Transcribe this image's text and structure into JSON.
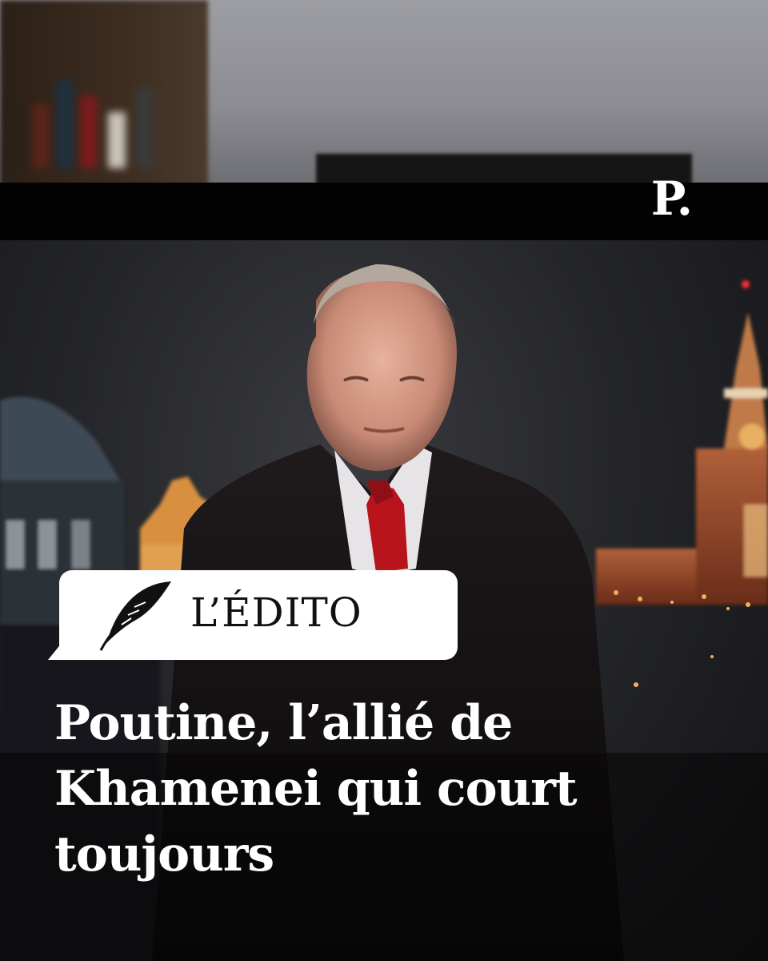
{
  "brand": {
    "logo_text": "P."
  },
  "badge": {
    "label": "L’ÉDITO",
    "icon": "quill-feather-icon"
  },
  "headline": {
    "lines": [
      "Poutine, l’allié de",
      "Khamenei qui court",
      "toujours"
    ]
  },
  "colors": {
    "text": "#ffffff",
    "badge_background": "#ffffff",
    "badge_text": "#111111",
    "tie": "#b8141c",
    "kremlin_lights": "#f0b060"
  }
}
